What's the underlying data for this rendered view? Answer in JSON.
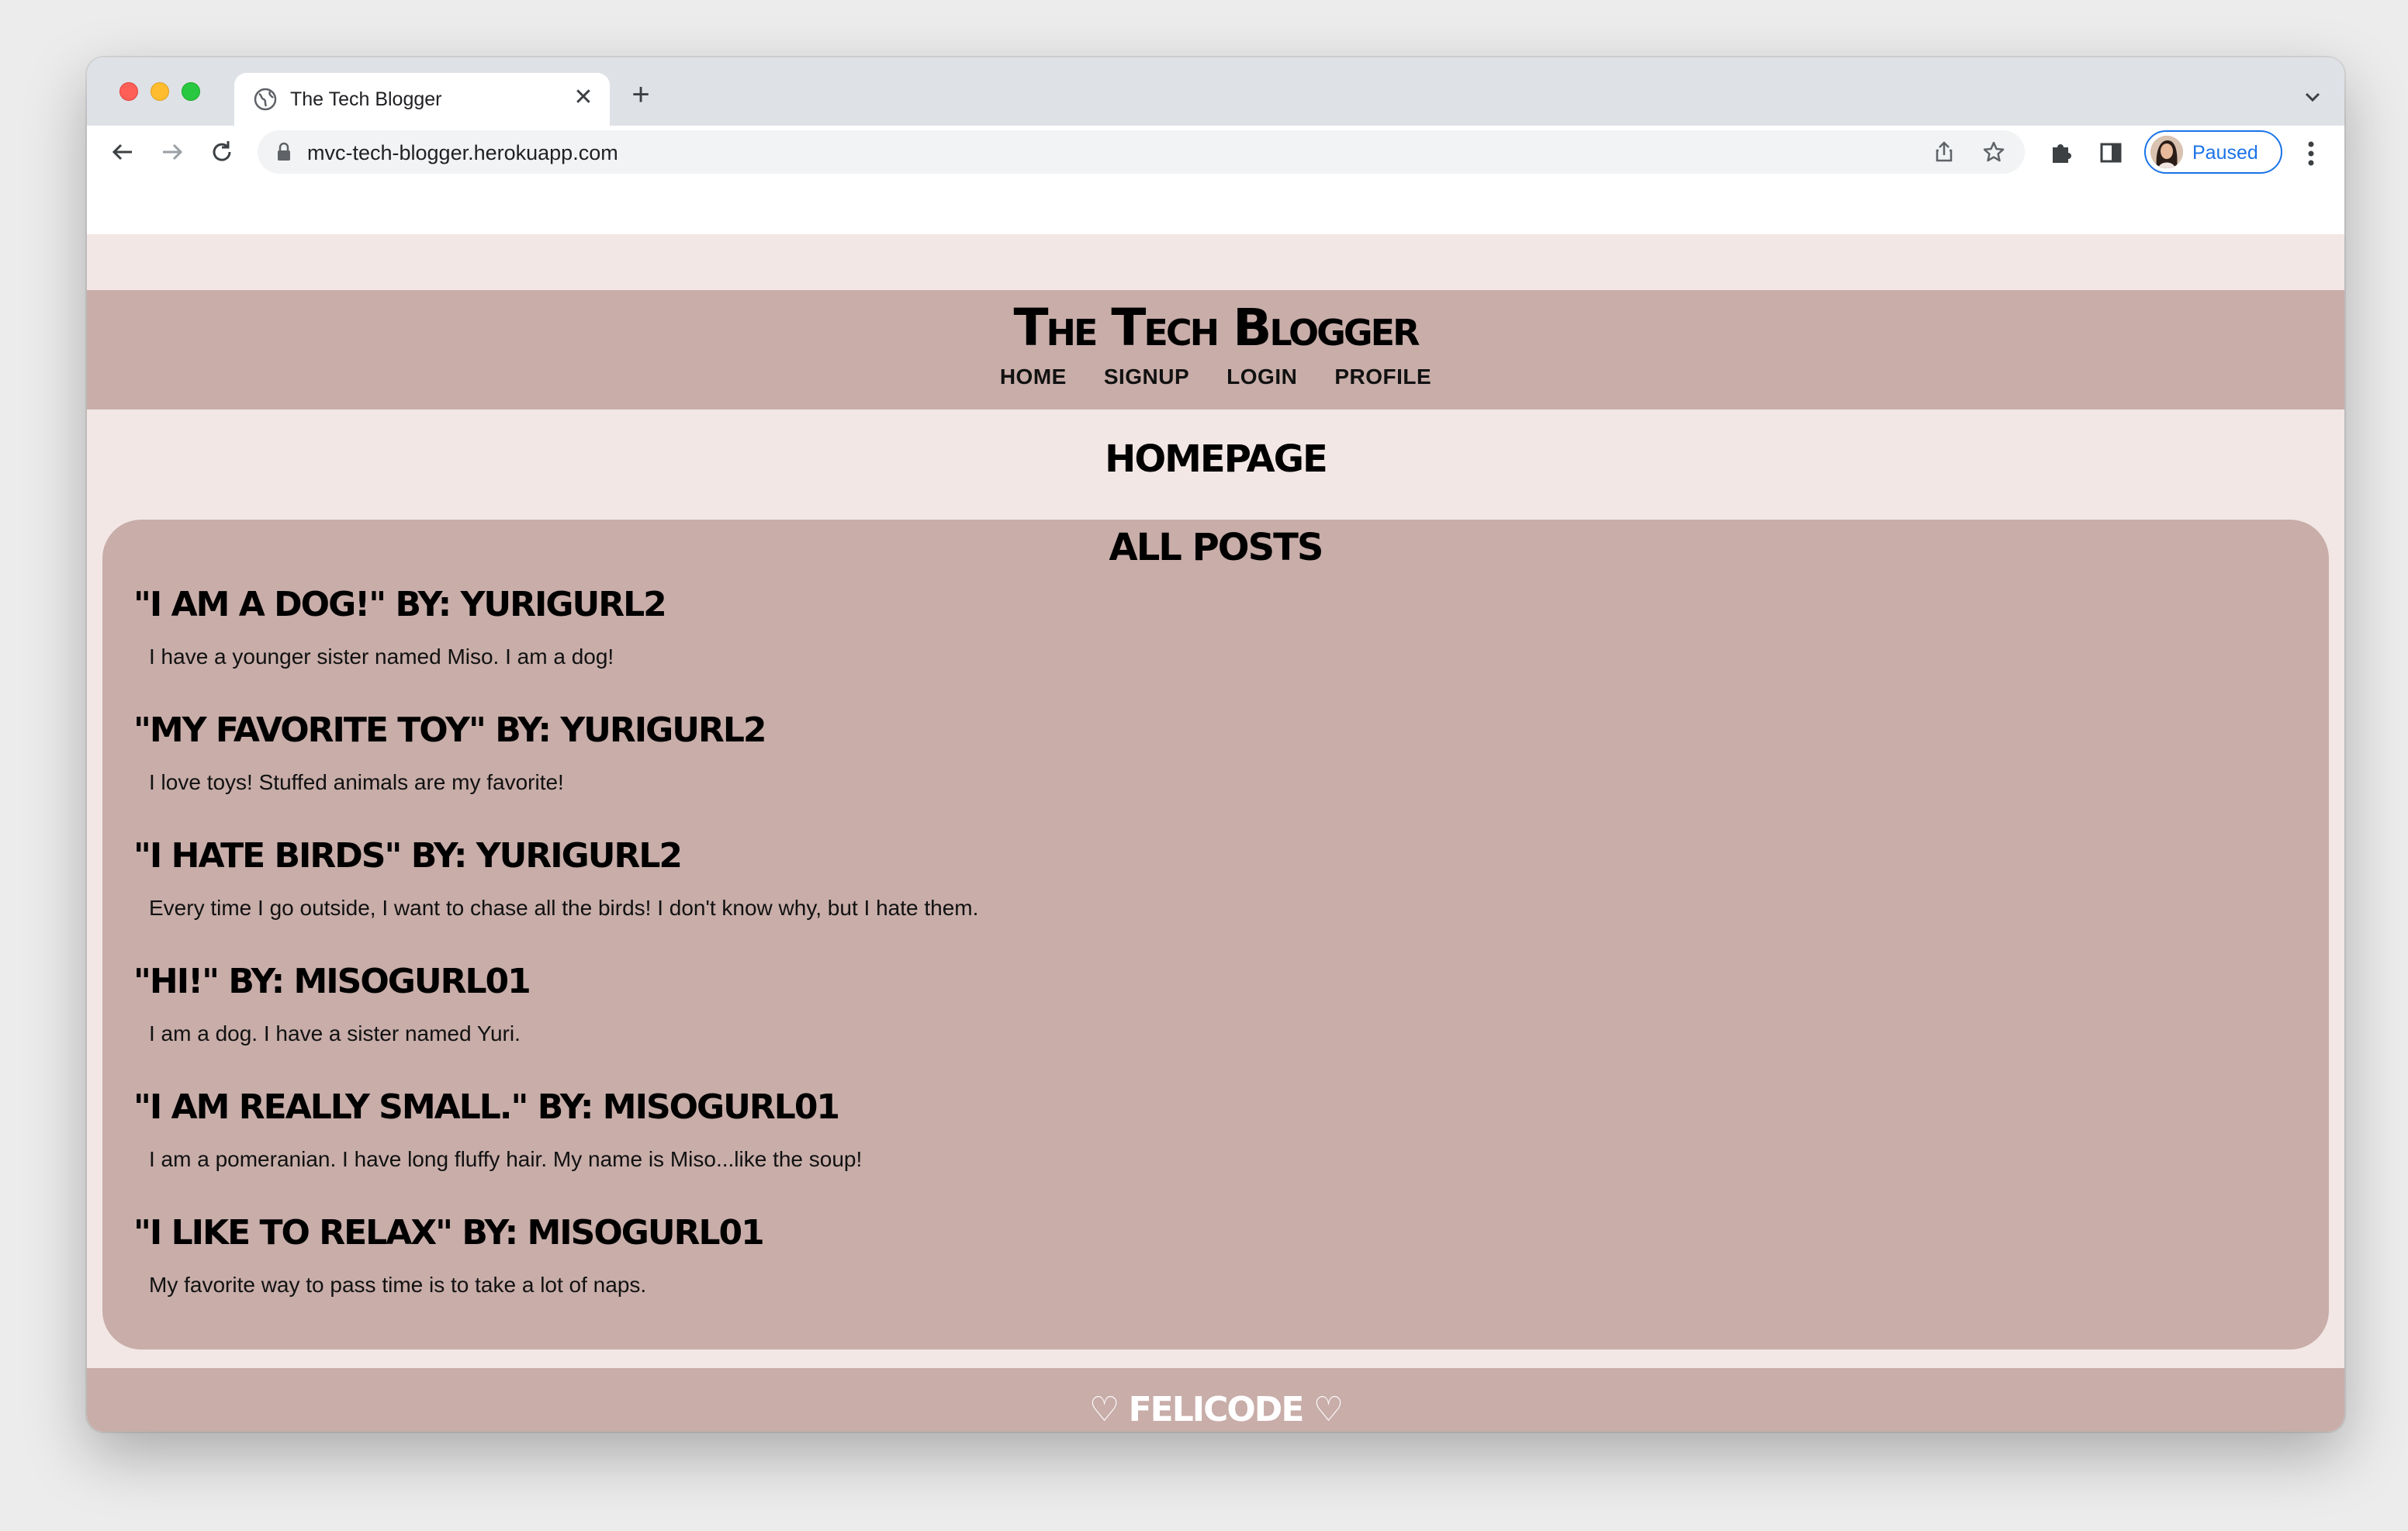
{
  "browser": {
    "tab_title": "The Tech Blogger",
    "url": "mvc-tech-blogger.herokuapp.com",
    "profile_status": "Paused",
    "icons": [
      "globe-icon",
      "close-icon",
      "plus-icon",
      "chevron-down-icon",
      "back-arrow-icon",
      "forward-arrow-icon",
      "reload-icon",
      "lock-icon",
      "share-icon",
      "star-icon",
      "puzzle-icon",
      "sidebar-icon",
      "more-vert-icon"
    ]
  },
  "site": {
    "title": "The Tech Blogger",
    "nav": [
      "HOME",
      "SIGNUP",
      "LOGIN",
      "PROFILE"
    ],
    "page_heading": "HOMEPAGE",
    "posts_heading": "All Posts",
    "posts": [
      {
        "title": "\"I am a dog!\" by: yurigurl2",
        "body": "I have a younger sister named Miso. I am a dog!"
      },
      {
        "title": "\"My favorite toy\" by: yurigurl2",
        "body": "I love toys! Stuffed animals are my favorite!"
      },
      {
        "title": "\"I hate birds\" by: yurigurl2",
        "body": "Every time I go outside, I want to chase all the birds! I don't know why, but I hate them."
      },
      {
        "title": "\"Hi!\" by: misogurl01",
        "body": "I am a dog. I have a sister named Yuri."
      },
      {
        "title": "\"I am really small.\" by: misogurl01",
        "body": "I am a pomeranian. I have long fluffy hair. My name is Miso...like the soup!"
      },
      {
        "title": "\"I like to relax\" by: misogurl01",
        "body": "My favorite way to pass time is to take a lot of naps."
      }
    ],
    "footer": "♡ FELICODE ♡"
  },
  "colors": {
    "header_bg": "#c8ada9",
    "page_bg": "#f2e7e4",
    "accent_blue": "#1a73e8"
  }
}
